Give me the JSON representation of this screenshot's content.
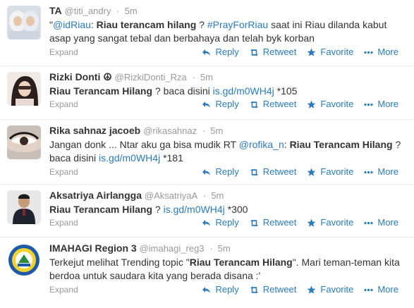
{
  "labels": {
    "expand": "Expand",
    "reply": "Reply",
    "retweet": "Retweet",
    "favorite": "Favorite",
    "more": "More",
    "time_sep": "·"
  },
  "tweets": [
    {
      "fullname": "TA",
      "username": "@titi_andry",
      "time": "5m",
      "text": [
        {
          "t": "\"",
          "s": ""
        },
        {
          "t": "@idRiau",
          "s": "link"
        },
        {
          "t": ": ",
          "s": ""
        },
        {
          "t": "Riau terancam hilang",
          "s": "b"
        },
        {
          "t": " ? ",
          "s": ""
        },
        {
          "t": "#PrayForRiau",
          "s": "link"
        },
        {
          "t": " saat ini Riau dilanda kabut asap yang sangat tebal dan berbahaya dan telah byk korban",
          "s": ""
        }
      ]
    },
    {
      "fullname": "Rizki Donti ☮",
      "username": "@RizkiDonti_Rza",
      "time": "5m",
      "text": [
        {
          "t": "Riau Terancam Hilang",
          "s": "b"
        },
        {
          "t": " ? baca disini ",
          "s": ""
        },
        {
          "t": "is.gd/m0WH4j",
          "s": "link"
        },
        {
          "t": " *105",
          "s": ""
        }
      ]
    },
    {
      "fullname": "Rika sahnaz jacoeb",
      "username": "@rikasahnaz",
      "time": "5m",
      "text": [
        {
          "t": "Jangan donk ... Ntar aku ga bisa mudik RT ",
          "s": ""
        },
        {
          "t": "@rofika_n",
          "s": "link"
        },
        {
          "t": ": ",
          "s": ""
        },
        {
          "t": "Riau Terancam Hilang",
          "s": "b"
        },
        {
          "t": " ? baca disini ",
          "s": ""
        },
        {
          "t": "is.gd/m0WH4j",
          "s": "link"
        },
        {
          "t": " *181",
          "s": ""
        }
      ]
    },
    {
      "fullname": "Aksatriya Airlangga",
      "username": "@AksatriyaA",
      "time": "5m",
      "text": [
        {
          "t": "Riau Terancam Hilang",
          "s": "b"
        },
        {
          "t": " ? ",
          "s": ""
        },
        {
          "t": "is.gd/m0WH4j",
          "s": "link"
        },
        {
          "t": " *300",
          "s": ""
        }
      ]
    },
    {
      "fullname": "IMAHAGI Region 3",
      "username": "@imahagi_reg3",
      "time": "5m",
      "text": [
        {
          "t": "Terkejut melihat Trending topic \"",
          "s": ""
        },
        {
          "t": "Riau Terancam Hilang",
          "s": "b"
        },
        {
          "t": "\". Mari teman-teman kita berdoa untuk saudara kita yang berada disana :'",
          "s": ""
        }
      ]
    }
  ],
  "colors": {
    "link": "#2b7bb9",
    "muted": "#999999",
    "text": "#333333"
  },
  "icons": {
    "reply": "reply-arrow-icon",
    "retweet": "retweet-arrows-icon",
    "favorite": "star-icon",
    "more": "ellipsis-icon"
  }
}
